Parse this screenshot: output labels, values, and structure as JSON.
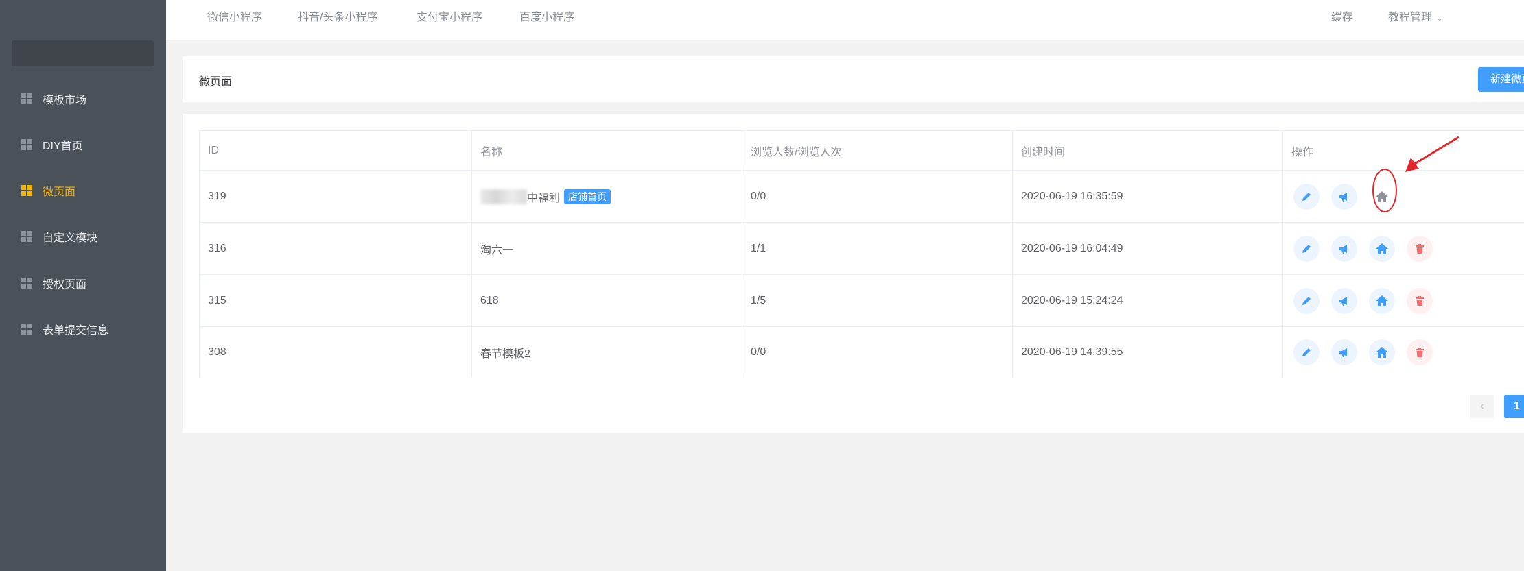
{
  "sidebar": {
    "items": [
      {
        "label": "模板市场",
        "active": false
      },
      {
        "label": "DIY首页",
        "active": false
      },
      {
        "label": "微页面",
        "active": true
      },
      {
        "label": "自定义模块",
        "active": false
      },
      {
        "label": "授权页面",
        "active": false
      },
      {
        "label": "表单提交信息",
        "active": false
      }
    ]
  },
  "topbar": {
    "tabs": [
      "微信小程序",
      "抖音/头条小程序",
      "支付宝小程序",
      "百度小程序"
    ],
    "cache_label": "缓存",
    "tutorial_label": "教程管理"
  },
  "header": {
    "title": "微页面",
    "new_button_label": "新建微页"
  },
  "table": {
    "columns": [
      "ID",
      "名称",
      "浏览人数/浏览人次",
      "创建时间",
      "操作"
    ],
    "rows": [
      {
        "id": "319",
        "name": "中福利",
        "tag": "店铺首页",
        "views": "0/0",
        "created": "2020-06-19 16:35:59",
        "is_home": true
      },
      {
        "id": "316",
        "name": "淘六一",
        "tag": "",
        "views": "1/1",
        "created": "2020-06-19 16:04:49",
        "is_home": false
      },
      {
        "id": "315",
        "name": "618",
        "tag": "",
        "views": "1/5",
        "created": "2020-06-19 15:24:24",
        "is_home": false
      },
      {
        "id": "308",
        "name": "春节模板2",
        "tag": "",
        "views": "0/0",
        "created": "2020-06-19 14:39:55",
        "is_home": false
      }
    ]
  },
  "pagination": {
    "prev_symbol": "‹",
    "current_page": "1"
  },
  "colors": {
    "sidebar_bg": "#4b5158",
    "active": "#f5b400",
    "primary": "#409eff",
    "danger": "#f56c6c",
    "annotation": "#e3262b"
  },
  "icons": [
    "grid-icon",
    "edit-icon",
    "megaphone-icon",
    "home-icon",
    "delete-icon",
    "chevron-down-icon"
  ]
}
